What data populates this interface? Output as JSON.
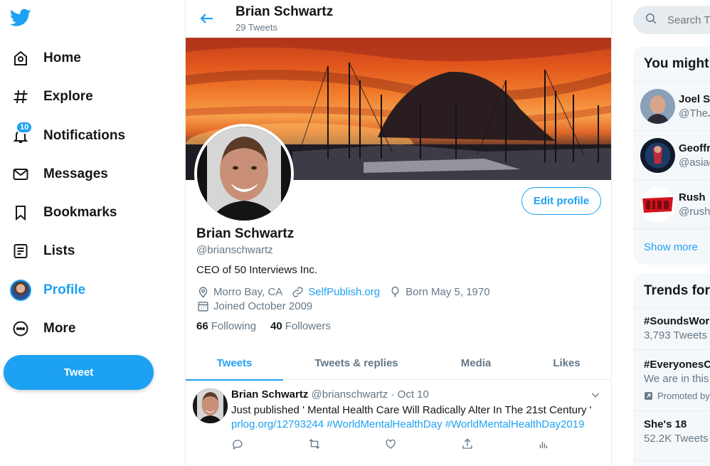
{
  "nav": {
    "items": [
      {
        "label": "Home",
        "icon": "home-icon"
      },
      {
        "label": "Explore",
        "icon": "hashtag-icon"
      },
      {
        "label": "Notifications",
        "icon": "bell-icon",
        "badge": "10"
      },
      {
        "label": "Messages",
        "icon": "envelope-icon"
      },
      {
        "label": "Bookmarks",
        "icon": "bookmark-icon"
      },
      {
        "label": "Lists",
        "icon": "list-icon"
      },
      {
        "label": "Profile",
        "icon": "avatar",
        "active": true
      },
      {
        "label": "More",
        "icon": "more-icon"
      }
    ],
    "tweet_button": "Tweet"
  },
  "header": {
    "name": "Brian Schwartz",
    "tweet_count": "29 Tweets"
  },
  "profile": {
    "name": "Brian Schwartz",
    "handle": "@brianschwartz",
    "bio": "CEO of 50 Interviews Inc.",
    "location": "Morro Bay, CA",
    "website": "SelfPublish.org",
    "birthday": "Born May 5, 1970",
    "joined": "Joined October 2009",
    "following_count": "66",
    "following_label": "Following",
    "followers_count": "40",
    "followers_label": "Followers",
    "edit_button": "Edit profile"
  },
  "tabs": [
    "Tweets",
    "Tweets & replies",
    "Media",
    "Likes"
  ],
  "tweet": {
    "name": "Brian Schwartz",
    "handle": "@brianschwartz",
    "separator": "·",
    "date": "Oct 10",
    "text": "Just published ' Mental Health Care Will Radically Alter In The 21st Century '",
    "link": "prlog.org/12793244 #WorldMentalHealthDay #WorldMentalHealthDay2019"
  },
  "right": {
    "search_placeholder": "Search Twitter",
    "who_to_follow_title": "You might like",
    "suggestions": [
      {
        "name": "Joel S",
        "handle": "@TheJ"
      },
      {
        "name": "Geoffr",
        "handle": "@asiag"
      },
      {
        "name": "Rush",
        "handle": "@rush"
      }
    ],
    "show_more": "Show more",
    "trends_title": "Trends for you",
    "trends": [
      {
        "title": "#SoundsWor",
        "sub": "3,793 Tweets"
      },
      {
        "title": "#EveryonesC",
        "sub": "We are in this",
        "promo": "Promoted by"
      },
      {
        "title": "She's 18",
        "sub": "52.2K Tweets"
      }
    ]
  },
  "colors": {
    "accent": "#1da1f2",
    "text": "#14171a",
    "muted": "#657786",
    "border": "#e6ecf0"
  }
}
